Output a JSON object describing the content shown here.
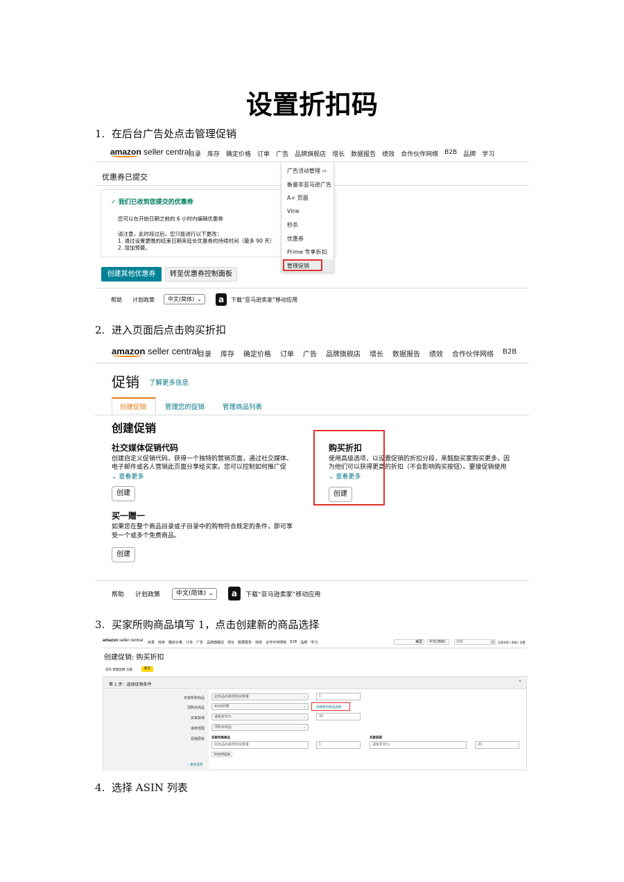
{
  "document": {
    "title": "设置折扣码",
    "steps": [
      {
        "num": "1.",
        "text": "在后台广告处点击管理促销"
      },
      {
        "num": "2.",
        "text": "进入页面后点击购买折扣"
      },
      {
        "num": "3.",
        "text": "买家所购商品填写 1，点击创建新的商品选择"
      },
      {
        "num": "4.",
        "text": "选择 ASIN 列表"
      }
    ]
  },
  "colors": {
    "amazon_orange": "#f08804",
    "teal_button": "#008296",
    "highlight_red": "#e0302a",
    "promo_tab_orange": "#e47911"
  },
  "shot1": {
    "logo_amazon": "amazon",
    "logo_sc": " seller central",
    "nav": [
      "目录",
      "库存",
      "确定价格",
      "订单",
      "广告",
      "品牌旗舰店",
      "增长",
      "数据报告",
      "绩效",
      "合作伙伴网络",
      "B2B",
      "品牌",
      "学习"
    ],
    "page_title": "优惠券已提交",
    "notice_title": "我们已收到您提交的优惠券",
    "notice_line1": "您可以在开始日期之前的 6 小时内编辑优惠券",
    "notice_line2": "请注意，此时段过后，您只能进行以下更改：",
    "notice_line3": "1. 通过设置更晚的结束日期来延长优惠券的持续时间（最多 90 天）",
    "notice_line4": "2. 增加预算。",
    "btn_create_other": "创建其他优惠券",
    "btn_dashboard": "转至优惠券控制面板",
    "dropdown": [
      "广告活动管理",
      "衡量非亚马逊广告",
      "A+ 页面",
      "Vine",
      "秒杀",
      "优惠券",
      "Prime 专享折扣",
      "管理促销"
    ],
    "footer_help": "帮助",
    "footer_policy": "计划政策",
    "footer_lang": "中文(简体)",
    "footer_app": "下载“亚马逊卖家”移动应用"
  },
  "shot2": {
    "logo_amazon": "amazon",
    "logo_sc": " seller central",
    "nav": [
      "目录",
      "库存",
      "确定价格",
      "订单",
      "广告",
      "品牌旗舰店",
      "增长",
      "数据报告",
      "绩效",
      "合作伙伴网络",
      "B2B"
    ],
    "page_title": "促销",
    "learn_more": "了解更多信息",
    "tabs": [
      "创建促销",
      "管理您的促销",
      "管理商品列表"
    ],
    "section_title": "创建促销",
    "social_title": "社交媒体促销代码",
    "social_desc1": "创建自定义促销代码，获得一个独特的营销页面，通过社交媒体、",
    "social_desc2": "电子邮件或名人营销此页面分享给买家。您可以控制如何推广促",
    "see_more": "查看更多",
    "create": "创建",
    "buy_title": "购买折扣",
    "buy_desc1": "使用高级选项，以设置促销的折扣分段，来鼓励买家购买更多，因",
    "buy_desc2": "为他们可以获得更高的折扣（不会影响购买按钮）。要接促销使用",
    "bogo_title": "买一赠一",
    "bogo_desc1": "如果您在整个商品目录或子目录中的购物符合既定的条件，即可享",
    "bogo_desc2": "受一个或多个免费商品。",
    "footer_help": "帮助",
    "footer_policy": "计划政策",
    "footer_lang": "中文(简体)",
    "footer_app": "下载“亚马逊卖家”移动应用"
  },
  "shot3": {
    "logo_amazon": "amazon",
    "logo_sc": " seller central",
    "nav": [
      "目录",
      "库存",
      "确定价格",
      "订单",
      "广告",
      "品牌旗舰店",
      "增长",
      "数据报告",
      "绩效",
      "合作伙伴网络",
      "B2B",
      "品牌",
      "学习"
    ],
    "store_selector": "美国",
    "lang": "中文(简体)",
    "search_placeholder": "搜索",
    "top_links": "买家消息 | 帮助 | 设置",
    "page_title": "创建促销: 购买折扣",
    "breadcrumb": "首页  管理促销  页面",
    "breadcrumb_current": "提交",
    "step1_title": "第 1 步：选择促销条件",
    "row_labels": [
      "买家所购商品",
      "须购买商品",
      "买家获得",
      "适用范围",
      "促销层级"
    ],
    "row_values": [
      "此商品的最低购买数量",
      "ASIN列表",
      "减免折扣%",
      "须购买商品"
    ],
    "input_qty": "1",
    "create_selection_link": "创建新的商品选择",
    "input_discount": "30",
    "tier_col_buy": "买家所购商品",
    "tier_col_get": "买家获得",
    "tier_buy_value": "此商品的最低购买数量",
    "tier_qty": "1",
    "tier_get_value": "减免折扣%",
    "tier_discount": "20",
    "add_tier": "添加促销层级",
    "more_options": "更多选项"
  }
}
